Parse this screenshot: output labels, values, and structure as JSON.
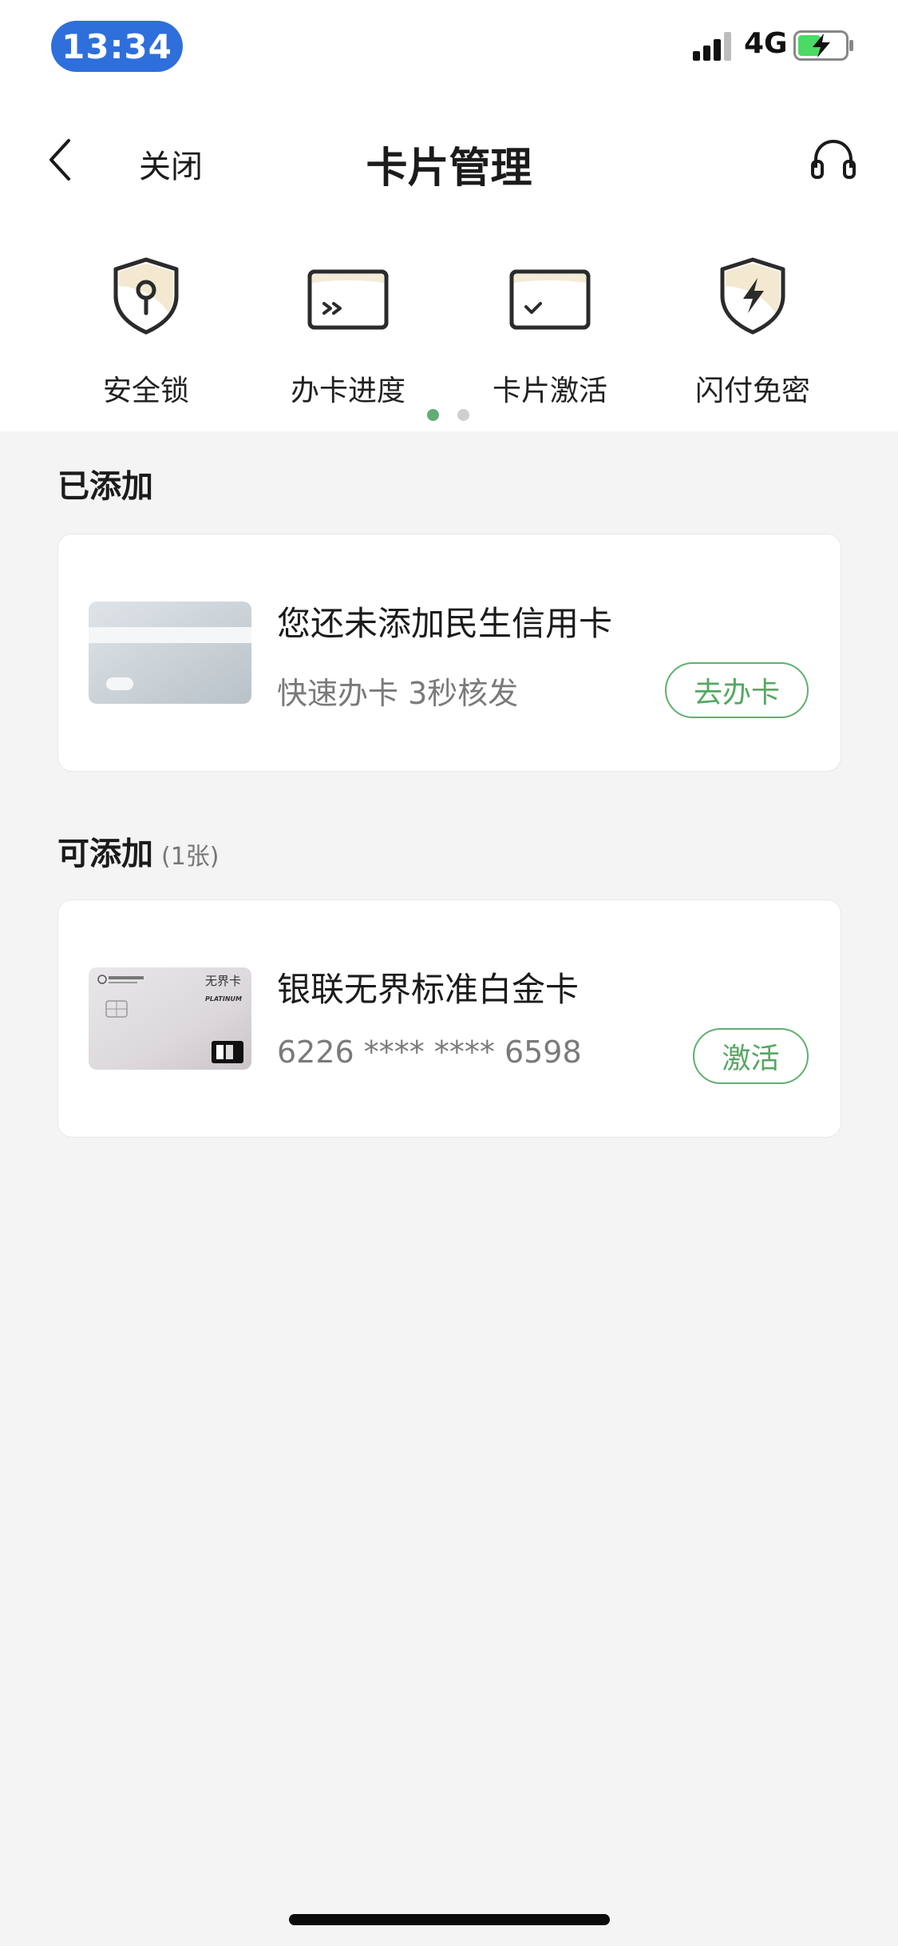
{
  "status_bar": {
    "time": "13:34",
    "network": "4G"
  },
  "nav": {
    "close_label": "关闭",
    "title": "卡片管理"
  },
  "shortcuts": [
    {
      "label": "安全锁",
      "icon": "shield-key-icon"
    },
    {
      "label": "办卡进度",
      "icon": "card-progress-icon"
    },
    {
      "label": "卡片激活",
      "icon": "card-activate-icon"
    },
    {
      "label": "闪付免密",
      "icon": "shield-lightning-icon"
    }
  ],
  "pager": {
    "pages": 2,
    "current": 1
  },
  "added_section": {
    "title": "已添加",
    "card": {
      "title": "您还未添加民生信用卡",
      "subtitle": "快速办卡 3秒核发",
      "button": "去办卡"
    }
  },
  "addable_section": {
    "title": "可添加",
    "count": "(1张)",
    "card": {
      "title": "银联无界标准白金卡",
      "number": "6226 **** **** 6598",
      "button": "激活",
      "thumb_text": {
        "brand": "无界卡",
        "tier": "PLATINUM"
      }
    }
  },
  "colors": {
    "accent": "#5fb06e",
    "time_pill": "#2f6fdc",
    "background": "#f4f4f4"
  }
}
